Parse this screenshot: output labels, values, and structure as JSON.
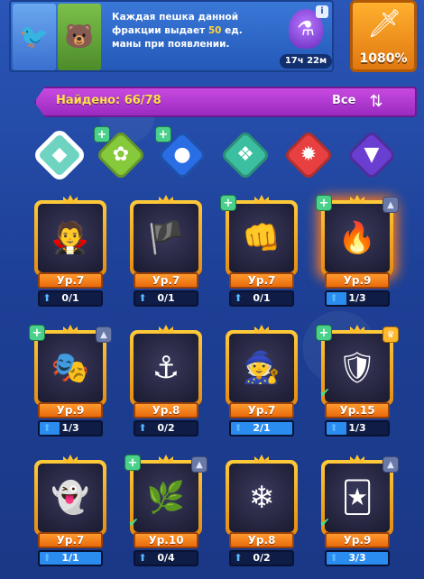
{
  "banner": {
    "text_before": "Каждая пешка данной фракции выдает ",
    "mana_amount": "50",
    "text_after": " ед. маны при появлении.",
    "timer": "17ч 22м",
    "info_icon": "i",
    "faction_icons": [
      "dragon-bird-icon",
      "bear-icon"
    ]
  },
  "power": {
    "value": "1080%",
    "icon": "sword-icon"
  },
  "header": {
    "found_label": "Найдено: 66/78",
    "sort_label": "Все",
    "sort_icon": "sort-arrows-icon"
  },
  "factions": [
    {
      "name": "all-factions",
      "glyph": "◆",
      "color": "#6fd3c2",
      "active": true,
      "plus": false
    },
    {
      "name": "nature-faction",
      "glyph": "✿",
      "color": "#86c93a",
      "active": false,
      "plus": true
    },
    {
      "name": "eight-ball-faction",
      "glyph": "●",
      "color": "#2a6ee6",
      "active": false,
      "plus": true
    },
    {
      "name": "wings-faction",
      "glyph": "❖",
      "color": "#3bbfa0",
      "active": false,
      "plus": false
    },
    {
      "name": "lightbulb-faction",
      "glyph": "✹",
      "color": "#e84040",
      "active": false,
      "plus": false
    },
    {
      "name": "bat-faction",
      "glyph": "▼",
      "color": "#6a3ed0",
      "active": false,
      "plus": false
    }
  ],
  "heroes": [
    {
      "level": "Ур.7",
      "progress": "0/1",
      "fill": 0,
      "icon": "vampire-icon",
      "plus": false,
      "star": "",
      "check": false,
      "glow": false
    },
    {
      "level": "Ур.7",
      "progress": "0/1",
      "fill": 0,
      "icon": "pirate-icon",
      "plus": false,
      "star": "",
      "check": false,
      "glow": false
    },
    {
      "level": "Ур.7",
      "progress": "0/1",
      "fill": 0,
      "icon": "brawler-icon",
      "plus": true,
      "star": "",
      "check": false,
      "glow": false
    },
    {
      "level": "Ур.9",
      "progress": "1/3",
      "fill": 0.33,
      "icon": "fire-warrior-icon",
      "plus": true,
      "star": "silver",
      "check": false,
      "glow": true
    },
    {
      "level": "Ур.9",
      "progress": "1/3",
      "fill": 0.33,
      "icon": "jester-mage-icon",
      "plus": true,
      "star": "silver",
      "check": false,
      "glow": false
    },
    {
      "level": "Ур.8",
      "progress": "0/2",
      "fill": 0,
      "icon": "pirate-girl-icon",
      "plus": false,
      "star": "",
      "check": false,
      "glow": false
    },
    {
      "level": "Ур.7",
      "progress": "2/1",
      "fill": 1,
      "icon": "witch-icon",
      "plus": false,
      "star": "",
      "check": false,
      "glow": false
    },
    {
      "level": "Ур.15",
      "progress": "1/3",
      "fill": 0.33,
      "icon": "armored-knight-icon",
      "plus": true,
      "star": "gold",
      "check": true,
      "glow": false
    },
    {
      "level": "Ур.7",
      "progress": "1/1",
      "fill": 1,
      "icon": "ghost-girl-icon",
      "plus": false,
      "star": "",
      "check": false,
      "glow": false
    },
    {
      "level": "Ур.10",
      "progress": "0/4",
      "fill": 0,
      "icon": "dryad-icon",
      "plus": true,
      "star": "silver",
      "check": true,
      "glow": false
    },
    {
      "level": "Ур.8",
      "progress": "0/2",
      "fill": 0,
      "icon": "ice-knight-icon",
      "plus": false,
      "star": "",
      "check": false,
      "glow": false
    },
    {
      "level": "Ур.9",
      "progress": "3/3",
      "fill": 1,
      "icon": "harlequin-icon",
      "plus": false,
      "star": "silver",
      "check": true,
      "glow": false
    }
  ],
  "colors": {
    "background": "#1f3f93",
    "banner": "#2f6ac8",
    "header": "#b23cd4",
    "card_frame": "#f4a320",
    "level_badge": "#f0821a",
    "progress_fill": "#2b8cf0"
  }
}
